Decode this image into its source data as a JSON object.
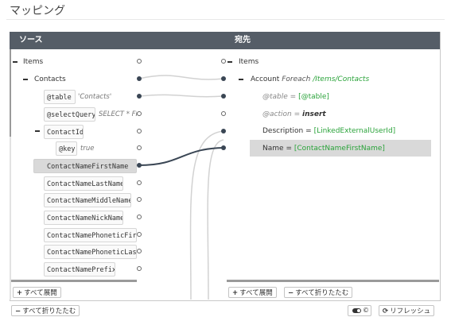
{
  "page": {
    "title": "マッピング"
  },
  "source": {
    "header": "ソース",
    "items_label": "Items",
    "contacts_label": "Contacts",
    "table_attr": "@table",
    "table_value": "'Contacts'",
    "selectquery_attr": "@selectQuery",
    "selectquery_value": "SELECT * FR",
    "contactid_label": "ContactId",
    "key_attr": "@key",
    "key_value": "true",
    "fields": [
      "ContactNameFirstName",
      "ContactNameLastName",
      "ContactNameMiddleName",
      "ContactNameNickName",
      "ContactNamePhoneticFirst",
      "ContactNamePhoneticLastN",
      "ContactNamePrefix"
    ],
    "expand_all": "すべて展開"
  },
  "destination": {
    "header": "宛先",
    "items_label": "Items",
    "account_label": "Account",
    "foreach_label": "Foreach",
    "foreach_path": "/Items/Contacts",
    "table_attr": "@table",
    "table_value": "[@table]",
    "action_attr": "@action",
    "action_value": "insert",
    "description_label": "Description",
    "description_value": "[LinkedExternalUserId]",
    "name_label": "Name",
    "name_value": "[ContactNameFirstName]",
    "equals": "=",
    "expand_all": "すべて展開",
    "collapse_all": "すべて折りたたむ"
  },
  "footer": {
    "collapse_all": "すべて折りたたむ",
    "toggle_icon": "toggle-switch-icon",
    "refresh": "リフレッシュ"
  },
  "colors": {
    "header_bg": "#555d67",
    "link_active": "#3a4654",
    "link_inactive": "#d2d2d2",
    "value_green": "#2aa33a",
    "selected_row": "#d9d9d9"
  }
}
